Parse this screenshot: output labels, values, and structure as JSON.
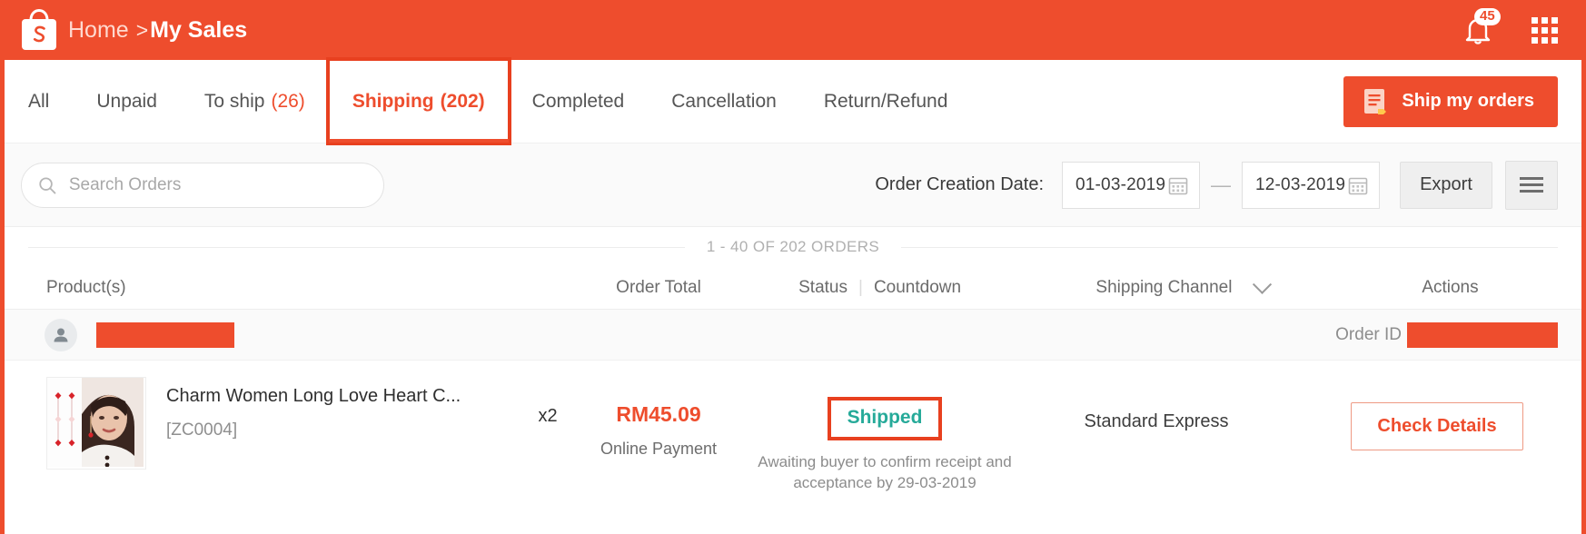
{
  "header": {
    "breadcrumb_home": "Home",
    "breadcrumb_separator": ">",
    "breadcrumb_current": "My Sales",
    "notification_count": "45",
    "brand_color": "#ee4d2d"
  },
  "tabs": {
    "items": [
      {
        "label": "All",
        "count": "",
        "active": false
      },
      {
        "label": "Unpaid",
        "count": "",
        "active": false
      },
      {
        "label": "To ship",
        "count": "(26)",
        "active": false
      },
      {
        "label": "Shipping",
        "count": "(202)",
        "active": true
      },
      {
        "label": "Completed",
        "count": "",
        "active": false
      },
      {
        "label": "Cancellation",
        "count": "",
        "active": false
      },
      {
        "label": "Return/Refund",
        "count": "",
        "active": false
      }
    ],
    "ship_button_label": "Ship my orders"
  },
  "filters": {
    "search_placeholder": "Search Orders",
    "search_value": "",
    "date_label": "Order Creation Date:",
    "date_from": "01-03-2019",
    "date_to": "12-03-2019",
    "date_separator": "—",
    "export_label": "Export"
  },
  "list": {
    "count_text": "1 - 40 OF 202 ORDERS",
    "columns": {
      "product": "Product(s)",
      "order_total": "Order Total",
      "status": "Status",
      "status_divider": "|",
      "countdown": "Countdown",
      "shipping_channel": "Shipping Channel",
      "actions": "Actions"
    },
    "order": {
      "buyer_name_redacted": true,
      "order_id_label": "Order ID",
      "order_id_redacted": true,
      "product_name": "Charm Women Long Love Heart C...",
      "product_sku": "[ZC0004]",
      "quantity": "x2",
      "order_total": "RM45.09",
      "payment_method": "Online Payment",
      "status": "Shipped",
      "status_color": "#26aa99",
      "countdown_note": "Awaiting buyer to confirm receipt and acceptance by 29-03-2019",
      "shipping_channel": "Standard Express",
      "action_label": "Check Details"
    }
  }
}
